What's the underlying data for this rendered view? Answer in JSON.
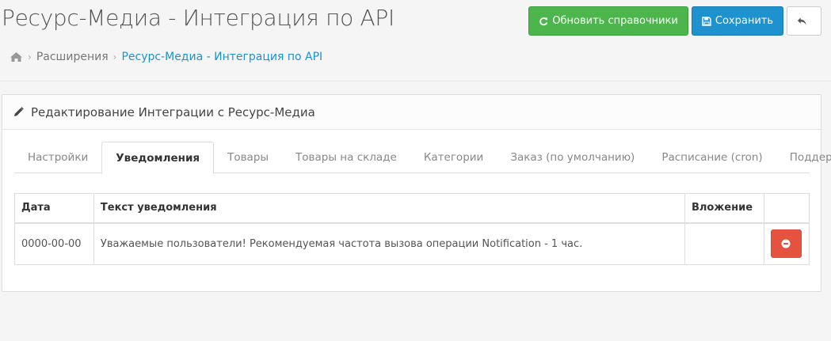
{
  "header": {
    "title": "Ресурс-Медиа - Интеграция по API",
    "refresh_label": "Обновить справочники",
    "save_label": "Сохранить"
  },
  "breadcrumb": {
    "items": [
      {
        "label": "Расширения"
      },
      {
        "label": "Ресурс-Медиа - Интеграция по API"
      }
    ]
  },
  "panel": {
    "title": "Редактирование Интеграции с Ресурс-Медиа"
  },
  "tabs": [
    {
      "label": "Настройки"
    },
    {
      "label": "Уведомления",
      "active": true
    },
    {
      "label": "Товары"
    },
    {
      "label": "Товары на складе"
    },
    {
      "label": "Категории"
    },
    {
      "label": "Заказ (по умолчанию)"
    },
    {
      "label": "Расписание (cron)"
    },
    {
      "label": "Поддержка"
    }
  ],
  "table": {
    "columns": [
      "Дата",
      "Текст уведомления",
      "Вложение",
      ""
    ],
    "rows": [
      {
        "date": "0000-00-00",
        "text": "Уважаемые пользователи! Рекомендуемая частота вызова операции Notification - 1 час.",
        "attachment": ""
      }
    ]
  },
  "colors": {
    "success": "#4cb64c",
    "primary": "#1e91cf",
    "danger": "#e5533f",
    "link": "#1e91cf"
  }
}
